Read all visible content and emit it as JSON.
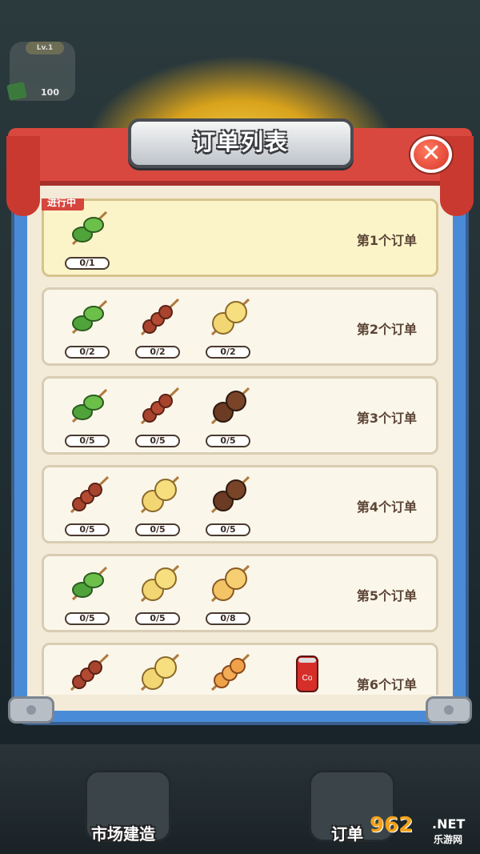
{
  "hud": {
    "level": "Lv.1",
    "coins": "100"
  },
  "panel": {
    "title": "订单列表",
    "close_label": "✕"
  },
  "active_tag": "进行中",
  "orders": [
    {
      "label": "第1个订单",
      "items": [
        {
          "type": "green-pepper-skewer",
          "count": "0/1"
        }
      ]
    },
    {
      "label": "第2个订单",
      "items": [
        {
          "type": "meat-skewer",
          "count": "0/2"
        },
        {
          "type": "meat-skewer",
          "count": "0/2"
        },
        {
          "type": "lotus-root-skewer",
          "count": "0/2"
        }
      ]
    },
    {
      "label": "第3个订单",
      "items": [
        {
          "type": "green-pepper-skewer",
          "count": "0/5"
        },
        {
          "type": "meat-skewer",
          "count": "0/5"
        },
        {
          "type": "mushroom-skewer",
          "count": "0/5"
        }
      ]
    },
    {
      "label": "第4个订单",
      "items": [
        {
          "type": "meat-skewer",
          "count": "0/5"
        },
        {
          "type": "lotus-root-skewer",
          "count": "0/5"
        },
        {
          "type": "mushroom-skewer",
          "count": "0/5"
        }
      ]
    },
    {
      "label": "第5个订单",
      "items": [
        {
          "type": "green-pepper-skewer",
          "count": "0/5"
        },
        {
          "type": "lotus-root-skewer",
          "count": "0/5"
        },
        {
          "type": "potato-skewer",
          "count": "0/8"
        }
      ]
    },
    {
      "label": "第6个订单",
      "items": [
        {
          "type": "meat-skewer",
          "count": ""
        },
        {
          "type": "lotus-root-skewer",
          "count": ""
        },
        {
          "type": "fishball-skewer",
          "count": ""
        },
        {
          "type": "cola-can",
          "count": ""
        }
      ]
    }
  ],
  "nav": {
    "build_label": "市场建造",
    "orders_label": "订单"
  },
  "watermark": {
    "big": "962",
    "net": ".NET",
    "sub": "乐游网"
  }
}
